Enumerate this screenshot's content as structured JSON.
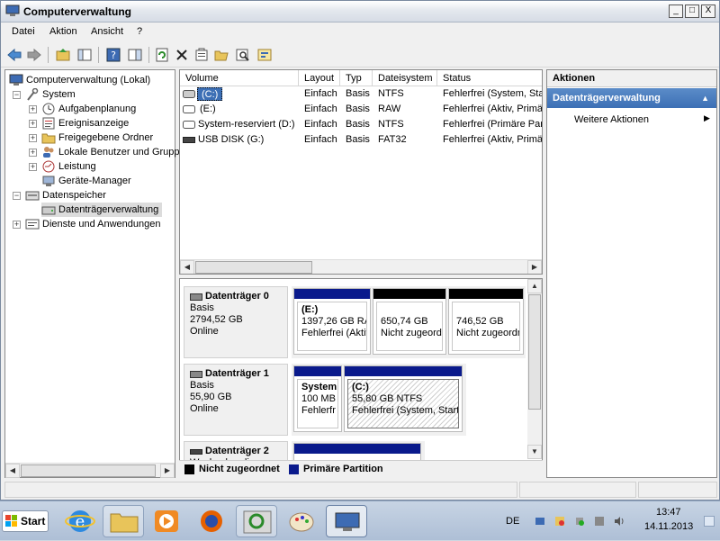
{
  "window": {
    "title": "Computerverwaltung",
    "controls": [
      "_",
      "□",
      "X"
    ]
  },
  "menu": [
    "Datei",
    "Aktion",
    "Ansicht",
    "?"
  ],
  "tree": {
    "root": "Computerverwaltung (Lokal)",
    "system": "System",
    "aufgabenplanung": "Aufgabenplanung",
    "ereignisanzeige": "Ereignisanzeige",
    "freigegebene_ordner": "Freigegebene Ordner",
    "lokale_benutzer": "Lokale Benutzer und Grupp",
    "leistung": "Leistung",
    "geraete_manager": "Geräte-Manager",
    "datenspeicher": "Datenspeicher",
    "datentraegerverwaltung": "Datenträgerverwaltung",
    "dienste": "Dienste und Anwendungen",
    "expand_plus": "+",
    "expand_minus": "−"
  },
  "volumes": {
    "columns": [
      "Volume",
      "Layout",
      "Typ",
      "Dateisystem",
      "Status"
    ],
    "rows": [
      {
        "volume": "(C:)",
        "layout": "Einfach",
        "typ": "Basis",
        "fs": "NTFS",
        "status": "Fehlerfrei (System, Sta"
      },
      {
        "volume": "(E:)",
        "layout": "Einfach",
        "typ": "Basis",
        "fs": "RAW",
        "status": "Fehlerfrei (Aktiv, Primä"
      },
      {
        "volume": "System-reserviert (D:)",
        "layout": "Einfach",
        "typ": "Basis",
        "fs": "NTFS",
        "status": "Fehlerfrei (Primäre Part"
      },
      {
        "volume": "USB DISK (G:)",
        "layout": "Einfach",
        "typ": "Basis",
        "fs": "FAT32",
        "status": "Fehlerfrei (Aktiv, Primä"
      }
    ]
  },
  "disks": [
    {
      "name": "Datenträger 0",
      "type": "Basis",
      "size": "2794,52 GB",
      "state": "Online",
      "partitions": [
        {
          "title": "(E:)",
          "size": "1397,26 GB RA",
          "status": "Fehlerfrei (Aktiv"
        },
        {
          "title": "",
          "size": "650,74 GB",
          "status": "Nicht zugeordn"
        },
        {
          "title": "",
          "size": "746,52 GB",
          "status": "Nicht zugeordn"
        }
      ]
    },
    {
      "name": "Datenträger 1",
      "type": "Basis",
      "size": "55,90 GB",
      "state": "Online",
      "partitions": [
        {
          "title": "System",
          "size": "100 MB N",
          "status": "Fehlerfr"
        },
        {
          "title": "(C:)",
          "size": "55,80 GB NTFS",
          "status": "Fehlerfrei (System, Start"
        }
      ]
    },
    {
      "name": "Datenträger 2",
      "type": "Wechselmedi"
    }
  ],
  "legend": {
    "unallocated": "Nicht zugeordnet",
    "primary": "Primäre Partition"
  },
  "actions": {
    "header": "Aktionen",
    "section": "Datenträgerverwaltung",
    "more": "Weitere Aktionen"
  },
  "taskbar": {
    "start": "Start",
    "lang": "DE",
    "time": "13:47",
    "date": "14.11.2013"
  },
  "colors": {
    "primary_partition": "#0a1a8c",
    "unallocated": "#000000",
    "selection_blue": "#3c6fb5"
  }
}
